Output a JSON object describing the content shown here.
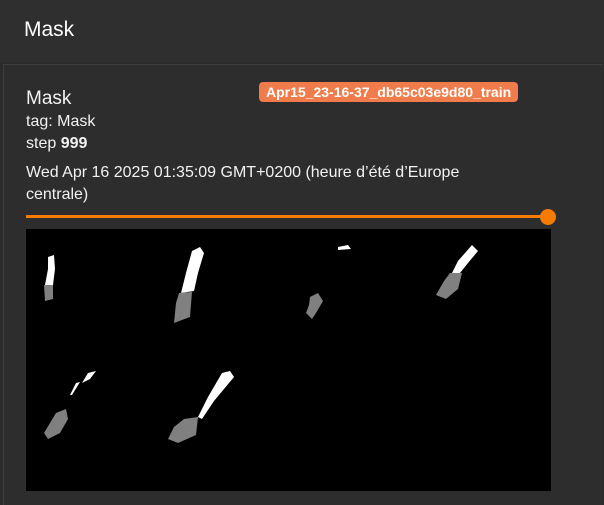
{
  "header": {
    "title": "Mask"
  },
  "card": {
    "title": "Mask",
    "run_badge": "Apr15_23-16-37_db65c03e9d80_train",
    "tag_prefix": "tag: ",
    "tag": "Mask",
    "step_prefix": "step ",
    "step": "999",
    "timestamp": "Wed Apr 16 2025 01:35:09 GMT+0200 (heure d’été d’Europe centrale)",
    "step_slider_fraction": 1.0
  },
  "colors": {
    "accent": "#f57c00",
    "badge": "#f07c4b",
    "mask_foreground": "#ffffff",
    "mask_predicted": "#808080",
    "background": "#000000"
  }
}
